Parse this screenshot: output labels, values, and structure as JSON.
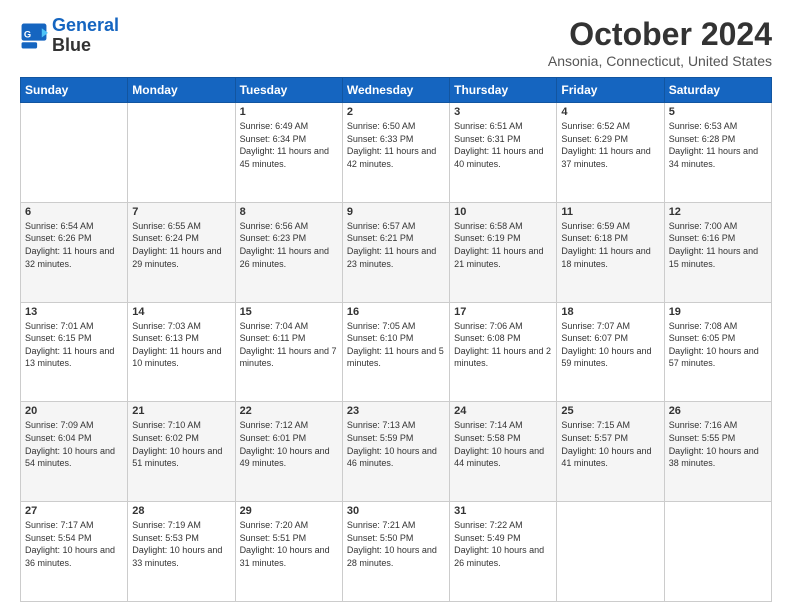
{
  "header": {
    "logo_line1": "General",
    "logo_line2": "Blue",
    "title": "October 2024",
    "subtitle": "Ansonia, Connecticut, United States"
  },
  "columns": [
    "Sunday",
    "Monday",
    "Tuesday",
    "Wednesday",
    "Thursday",
    "Friday",
    "Saturday"
  ],
  "weeks": [
    [
      {
        "day": "",
        "info": ""
      },
      {
        "day": "",
        "info": ""
      },
      {
        "day": "1",
        "info": "Sunrise: 6:49 AM\nSunset: 6:34 PM\nDaylight: 11 hours and 45 minutes."
      },
      {
        "day": "2",
        "info": "Sunrise: 6:50 AM\nSunset: 6:33 PM\nDaylight: 11 hours and 42 minutes."
      },
      {
        "day": "3",
        "info": "Sunrise: 6:51 AM\nSunset: 6:31 PM\nDaylight: 11 hours and 40 minutes."
      },
      {
        "day": "4",
        "info": "Sunrise: 6:52 AM\nSunset: 6:29 PM\nDaylight: 11 hours and 37 minutes."
      },
      {
        "day": "5",
        "info": "Sunrise: 6:53 AM\nSunset: 6:28 PM\nDaylight: 11 hours and 34 minutes."
      }
    ],
    [
      {
        "day": "6",
        "info": "Sunrise: 6:54 AM\nSunset: 6:26 PM\nDaylight: 11 hours and 32 minutes."
      },
      {
        "day": "7",
        "info": "Sunrise: 6:55 AM\nSunset: 6:24 PM\nDaylight: 11 hours and 29 minutes."
      },
      {
        "day": "8",
        "info": "Sunrise: 6:56 AM\nSunset: 6:23 PM\nDaylight: 11 hours and 26 minutes."
      },
      {
        "day": "9",
        "info": "Sunrise: 6:57 AM\nSunset: 6:21 PM\nDaylight: 11 hours and 23 minutes."
      },
      {
        "day": "10",
        "info": "Sunrise: 6:58 AM\nSunset: 6:19 PM\nDaylight: 11 hours and 21 minutes."
      },
      {
        "day": "11",
        "info": "Sunrise: 6:59 AM\nSunset: 6:18 PM\nDaylight: 11 hours and 18 minutes."
      },
      {
        "day": "12",
        "info": "Sunrise: 7:00 AM\nSunset: 6:16 PM\nDaylight: 11 hours and 15 minutes."
      }
    ],
    [
      {
        "day": "13",
        "info": "Sunrise: 7:01 AM\nSunset: 6:15 PM\nDaylight: 11 hours and 13 minutes."
      },
      {
        "day": "14",
        "info": "Sunrise: 7:03 AM\nSunset: 6:13 PM\nDaylight: 11 hours and 10 minutes."
      },
      {
        "day": "15",
        "info": "Sunrise: 7:04 AM\nSunset: 6:11 PM\nDaylight: 11 hours and 7 minutes."
      },
      {
        "day": "16",
        "info": "Sunrise: 7:05 AM\nSunset: 6:10 PM\nDaylight: 11 hours and 5 minutes."
      },
      {
        "day": "17",
        "info": "Sunrise: 7:06 AM\nSunset: 6:08 PM\nDaylight: 11 hours and 2 minutes."
      },
      {
        "day": "18",
        "info": "Sunrise: 7:07 AM\nSunset: 6:07 PM\nDaylight: 10 hours and 59 minutes."
      },
      {
        "day": "19",
        "info": "Sunrise: 7:08 AM\nSunset: 6:05 PM\nDaylight: 10 hours and 57 minutes."
      }
    ],
    [
      {
        "day": "20",
        "info": "Sunrise: 7:09 AM\nSunset: 6:04 PM\nDaylight: 10 hours and 54 minutes."
      },
      {
        "day": "21",
        "info": "Sunrise: 7:10 AM\nSunset: 6:02 PM\nDaylight: 10 hours and 51 minutes."
      },
      {
        "day": "22",
        "info": "Sunrise: 7:12 AM\nSunset: 6:01 PM\nDaylight: 10 hours and 49 minutes."
      },
      {
        "day": "23",
        "info": "Sunrise: 7:13 AM\nSunset: 5:59 PM\nDaylight: 10 hours and 46 minutes."
      },
      {
        "day": "24",
        "info": "Sunrise: 7:14 AM\nSunset: 5:58 PM\nDaylight: 10 hours and 44 minutes."
      },
      {
        "day": "25",
        "info": "Sunrise: 7:15 AM\nSunset: 5:57 PM\nDaylight: 10 hours and 41 minutes."
      },
      {
        "day": "26",
        "info": "Sunrise: 7:16 AM\nSunset: 5:55 PM\nDaylight: 10 hours and 38 minutes."
      }
    ],
    [
      {
        "day": "27",
        "info": "Sunrise: 7:17 AM\nSunset: 5:54 PM\nDaylight: 10 hours and 36 minutes."
      },
      {
        "day": "28",
        "info": "Sunrise: 7:19 AM\nSunset: 5:53 PM\nDaylight: 10 hours and 33 minutes."
      },
      {
        "day": "29",
        "info": "Sunrise: 7:20 AM\nSunset: 5:51 PM\nDaylight: 10 hours and 31 minutes."
      },
      {
        "day": "30",
        "info": "Sunrise: 7:21 AM\nSunset: 5:50 PM\nDaylight: 10 hours and 28 minutes."
      },
      {
        "day": "31",
        "info": "Sunrise: 7:22 AM\nSunset: 5:49 PM\nDaylight: 10 hours and 26 minutes."
      },
      {
        "day": "",
        "info": ""
      },
      {
        "day": "",
        "info": ""
      }
    ]
  ]
}
